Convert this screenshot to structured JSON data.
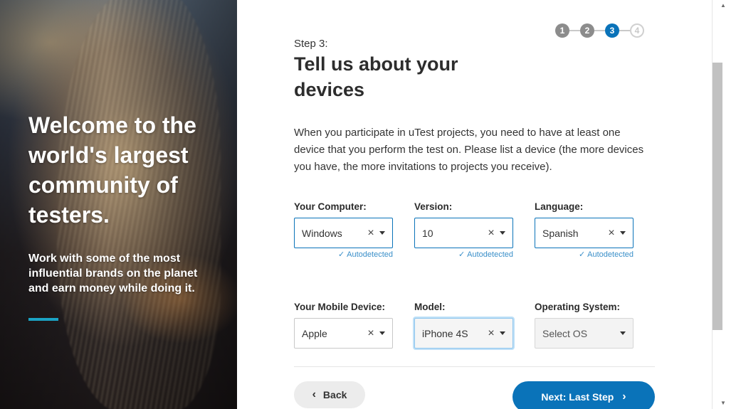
{
  "hero": {
    "title": "Welcome to the world's largest community of testers.",
    "subtitle": "Work with some of the most influential brands on the planet and earn money while doing it."
  },
  "stepper": {
    "steps": [
      "1",
      "2",
      "3",
      "4"
    ],
    "current": 3,
    "colors": {
      "done": "#8c8c8c",
      "active": "#0a73b9",
      "pending": "#d0d0d0"
    }
  },
  "heading": {
    "step_label": "Step 3:",
    "title": "Tell us about your devices",
    "intro": "When you participate in uTest projects, you need to have at least one device that you perform the test on. Please list a device (the more devices you have, the more invitations to projects you receive)."
  },
  "computer": {
    "computer_label": "Your Computer:",
    "computer_value": "Windows",
    "version_label": "Version:",
    "version_value": "10",
    "language_label": "Language:",
    "language_value": "Spanish",
    "autodetected": "Autodetected"
  },
  "mobile": {
    "device_label": "Your Mobile Device:",
    "device_value": "Apple",
    "model_label": "Model:",
    "model_value": "iPhone 4S",
    "os_label": "Operating System:",
    "os_placeholder": "Select OS"
  },
  "buttons": {
    "back": "Back",
    "next": "Next: Last Step"
  },
  "icons": {
    "clear": "close-icon",
    "dropdown": "caret-down-icon",
    "check": "check-icon",
    "back": "chevron-left-icon",
    "next": "chevron-right-icon"
  },
  "theme": {
    "accent": "#0a73b9",
    "hero_bar": "#1ba3c4"
  }
}
